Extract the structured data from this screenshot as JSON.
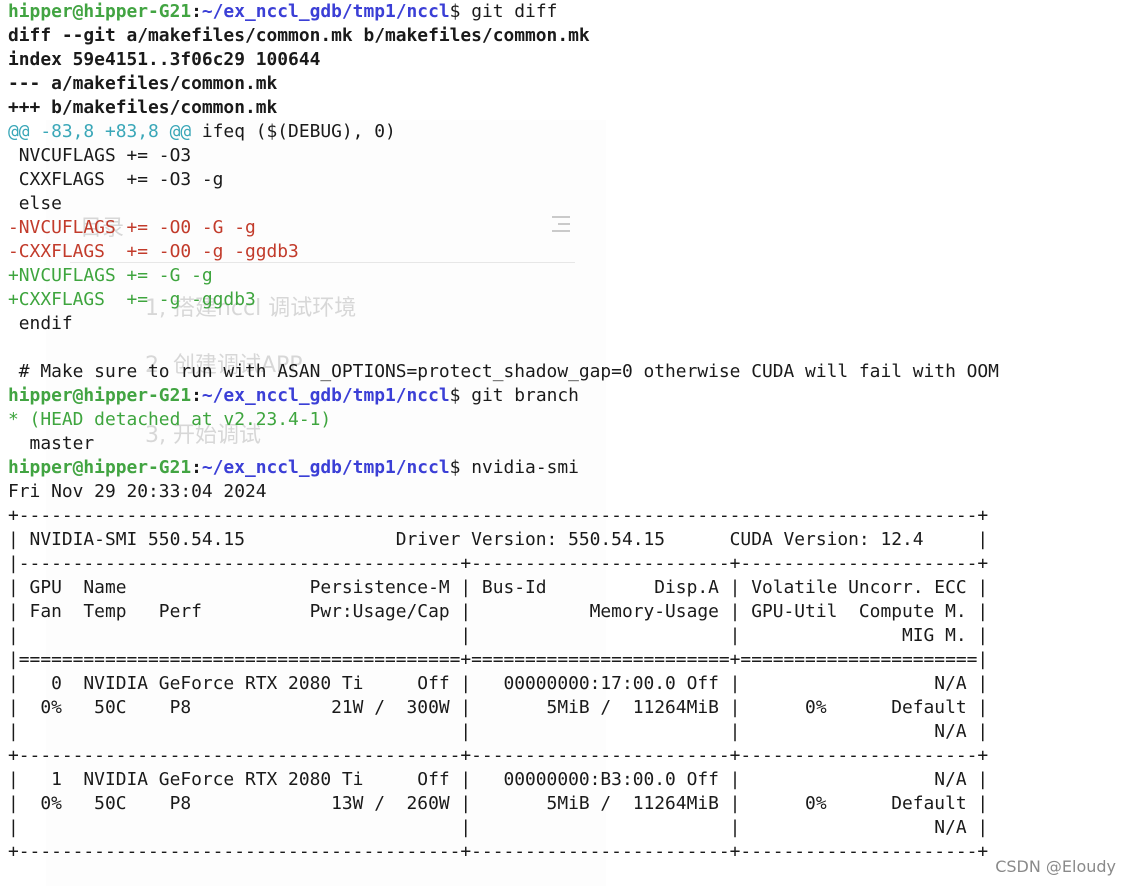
{
  "prompt": {
    "user": "hipper@hipper-G21",
    "sep": ":",
    "path": "~/ex_nccl_gdb/tmp1/nccl",
    "dollar": "$"
  },
  "cmd1": " git diff",
  "diff_header": [
    "diff --git a/makefiles/common.mk b/makefiles/common.mk",
    "index 59e4151..3f06c29 100644",
    "--- a/makefiles/common.mk",
    "+++ b/makefiles/common.mk"
  ],
  "hunk": {
    "marker": "@@ -83,8 +83,8 @@",
    "context": " ifeq ($(DEBUG), 0)"
  },
  "context_lines": [
    " NVCUFLAGS += -O3",
    " CXXFLAGS  += -O3 -g",
    " else"
  ],
  "removed_lines": [
    "-NVCUFLAGS += -O0 -G -g",
    "-CXXFLAGS  += -O0 -g -ggdb3"
  ],
  "added_lines": [
    "+NVCUFLAGS += -G -g",
    "+CXXFLAGS  += -g -ggdb3"
  ],
  "trailing_lines": [
    " endif",
    "",
    " # Make sure to run with ASAN_OPTIONS=protect_shadow_gap=0 otherwise CUDA will fail with OOM"
  ],
  "cmd2": " git branch",
  "branch_lines": {
    "current": "* (HEAD detached at v2.23.4-1)",
    "other": "  master"
  },
  "cmd3": " nvidia-smi",
  "smi_lines": [
    "Fri Nov 29 20:33:04 2024",
    "+-----------------------------------------------------------------------------------------+",
    "| NVIDIA-SMI 550.54.15              Driver Version: 550.54.15      CUDA Version: 12.4     |",
    "|-----------------------------------------+------------------------+----------------------+",
    "| GPU  Name                 Persistence-M | Bus-Id          Disp.A | Volatile Uncorr. ECC |",
    "| Fan  Temp   Perf          Pwr:Usage/Cap |           Memory-Usage | GPU-Util  Compute M. |",
    "|                                         |                        |               MIG M. |",
    "|=========================================+========================+======================|",
    "|   0  NVIDIA GeForce RTX 2080 Ti     Off |   00000000:17:00.0 Off |                  N/A |",
    "|  0%   50C    P8             21W /  300W |       5MiB /  11264MiB |      0%      Default |",
    "|                                         |                        |                  N/A |",
    "+-----------------------------------------+------------------------+----------------------+",
    "|   1  NVIDIA GeForce RTX 2080 Ti     Off |   00000000:B3:00.0 Off |                  N/A |",
    "|  0%   50C    P8             13W /  260W |       5MiB /  11264MiB |      0%      Default |",
    "|                                         |                        |                  N/A |",
    "+-----------------------------------------+------------------------+----------------------+"
  ],
  "ghost": {
    "toc_title": "目录",
    "item1": "1, 搭建nccl 调试环境",
    "item2": "2, 创建调试APP",
    "item3": "3, 开始调试"
  },
  "watermark": "CSDN @Eloudy",
  "colors": {
    "user": "#42a442",
    "path": "#3b3fd6",
    "hunk": "#3aa7b8",
    "removed": "#c23b2b",
    "added": "#3ea53e"
  }
}
